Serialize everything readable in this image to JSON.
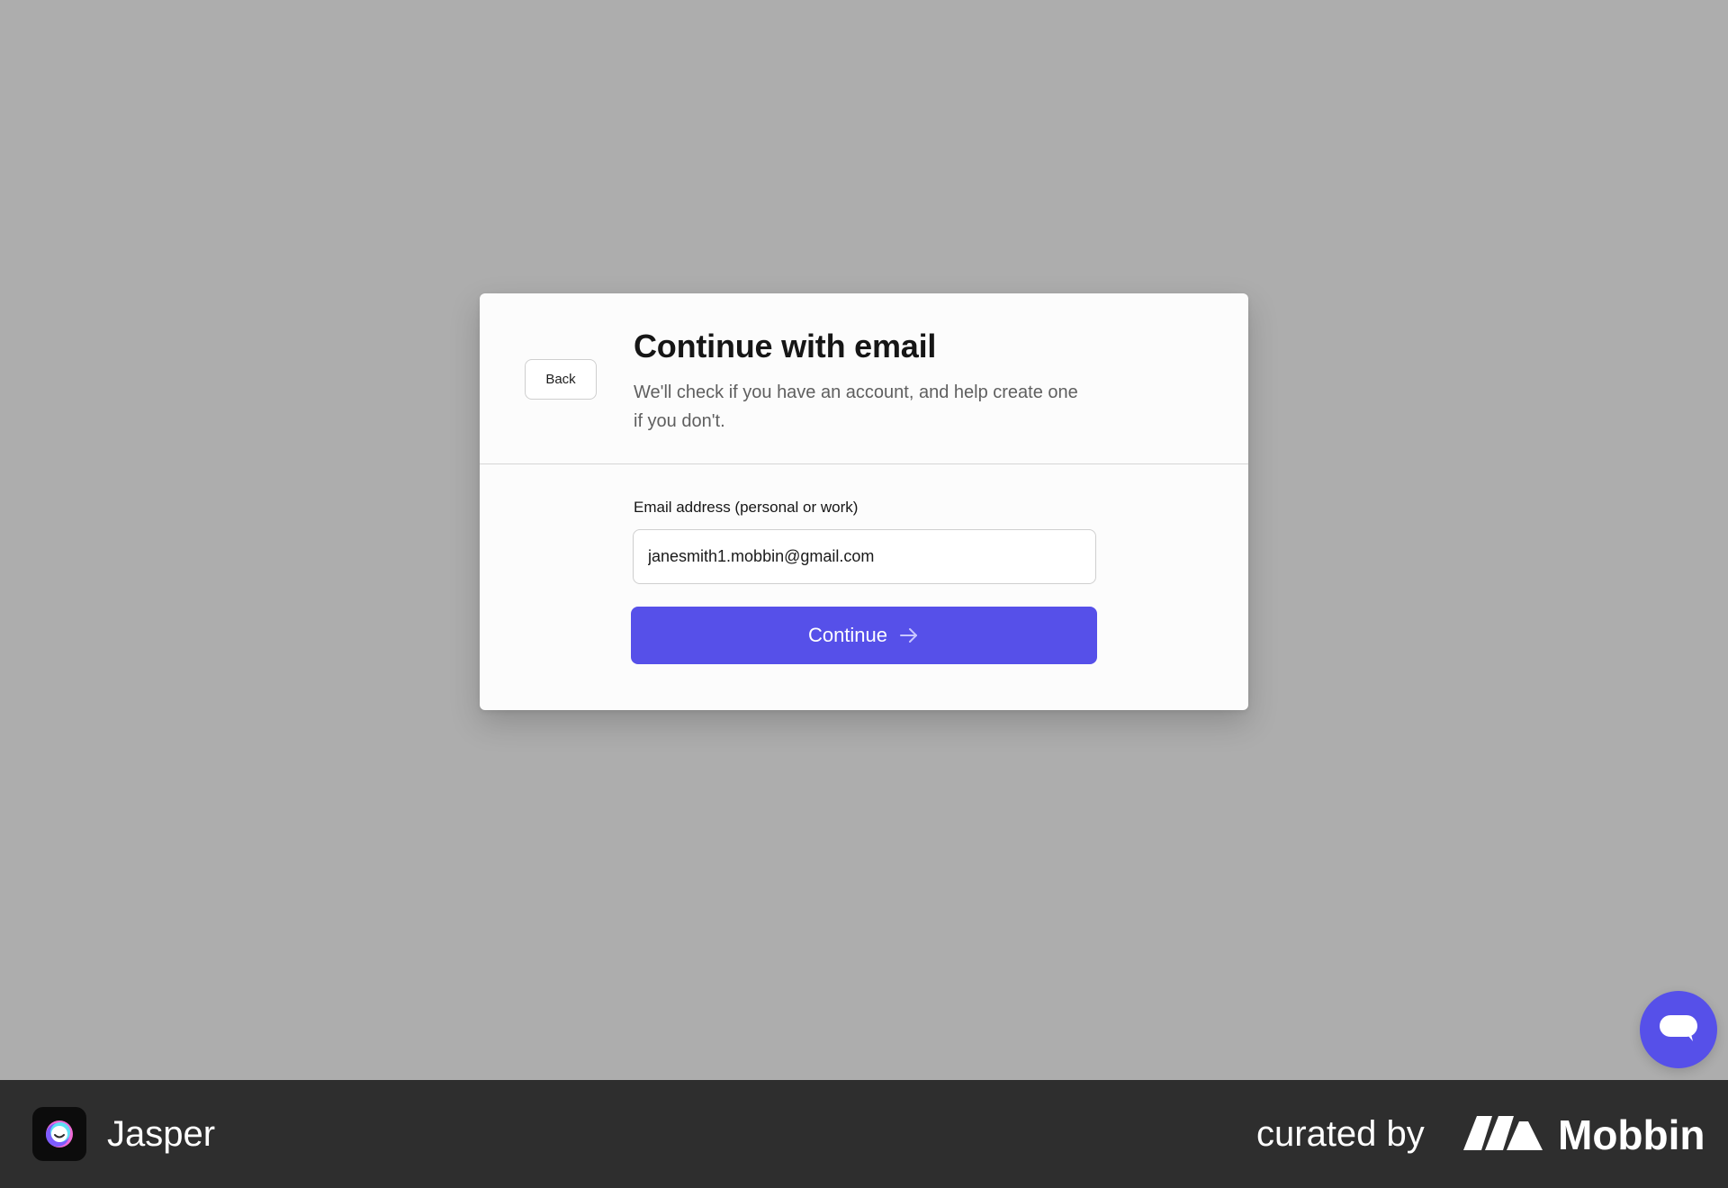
{
  "modal": {
    "back_label": "Back",
    "title": "Continue with email",
    "subtitle": "We'll check if you have an account, and help create one if you don't.",
    "email_label": "Email address (personal or work)",
    "email_value": "janesmith1.mobbin@gmail.com",
    "continue_label": "Continue",
    "continue_icon": "arrow-right-icon"
  },
  "chat": {
    "icon": "chat-bubble-icon"
  },
  "footer": {
    "app_icon": "jasper-logo-icon",
    "app_name": "Jasper",
    "curated_by": "curated by",
    "brand_logo": "mobbin-logo-icon",
    "brand_name": "Mobbin"
  },
  "colors": {
    "backdrop": "#adadad",
    "primary": "#5650e9",
    "footer_bg": "#2e2e2e",
    "card_bg": "#fcfcfc"
  }
}
